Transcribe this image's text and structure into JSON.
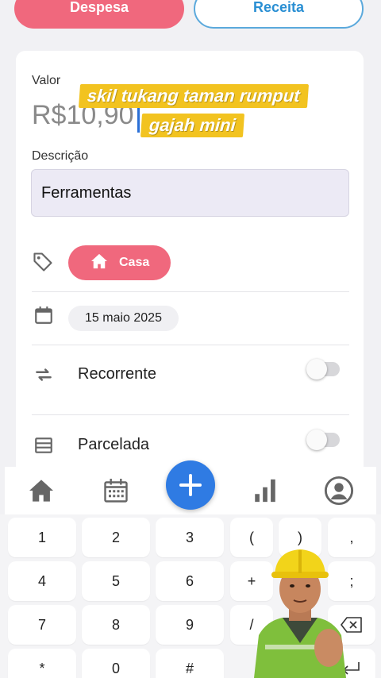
{
  "type_toggle": {
    "expense": "Despesa",
    "income": "Receita"
  },
  "form": {
    "value_label": "Valor",
    "value": "R$10,90",
    "description_label": "Descrição",
    "description_value": "Ferramentas",
    "category": "Casa",
    "date": "15 maio 2025",
    "recurring_label": "Recorrente",
    "installment_label": "Parcelada"
  },
  "caption": {
    "line1": "skil tukang taman rumput",
    "line2": "gajah mini"
  },
  "nav": [
    "home-icon",
    "calendar-icon",
    "add-icon",
    "chart-icon",
    "profile-icon"
  ],
  "keypad": {
    "row1": [
      "1",
      "2",
      "3",
      "(",
      ")",
      ","
    ],
    "row2": [
      "4",
      "5",
      "6",
      "+",
      ";"
    ],
    "row3": [
      "7",
      "8",
      "9",
      "/"
    ],
    "row4": [
      "*",
      "0",
      "#"
    ]
  },
  "colors": {
    "accent_expense": "#f0687d",
    "accent_income": "#2a8fd3",
    "fab": "#2f7be3"
  }
}
